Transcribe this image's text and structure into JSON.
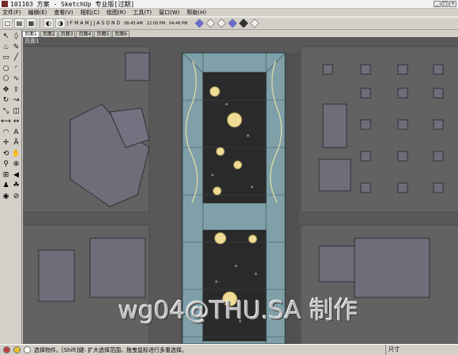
{
  "window": {
    "title": "101103 方案 - SketchUp 专业版[过期]",
    "buttons": [
      "_",
      "□",
      "×"
    ]
  },
  "menu": [
    "文件(F)",
    "编辑(E)",
    "查看(V)",
    "相机(C)",
    "绘图(R)",
    "工具(T)",
    "窗口(W)",
    "帮助(H)"
  ],
  "toolbar": {
    "months": [
      "J",
      "F",
      "M",
      "A",
      "M",
      "J",
      "J",
      "A",
      "S",
      "O",
      "N",
      "D"
    ],
    "times": [
      "06:43 AM",
      "12:00 PM",
      "04:46 PM"
    ]
  },
  "tabs": [
    "页面1",
    "页面2",
    "页面3",
    "页面4",
    "页面5",
    "页面6"
  ],
  "scene_tag": "页面1",
  "watermark": "wg04@THU.SA 制作",
  "status": {
    "message": "选择物件。[Shift]键: 扩大选择范围。拖曳鼠标进行多重选择。",
    "measure_label": "尺寸"
  },
  "colors": {
    "background": "#d4d0c8",
    "ground": "#5a5a5a",
    "plaza": "#2a2a2a",
    "glass": "#7fa0a8",
    "lamp": "#f0dc96"
  }
}
